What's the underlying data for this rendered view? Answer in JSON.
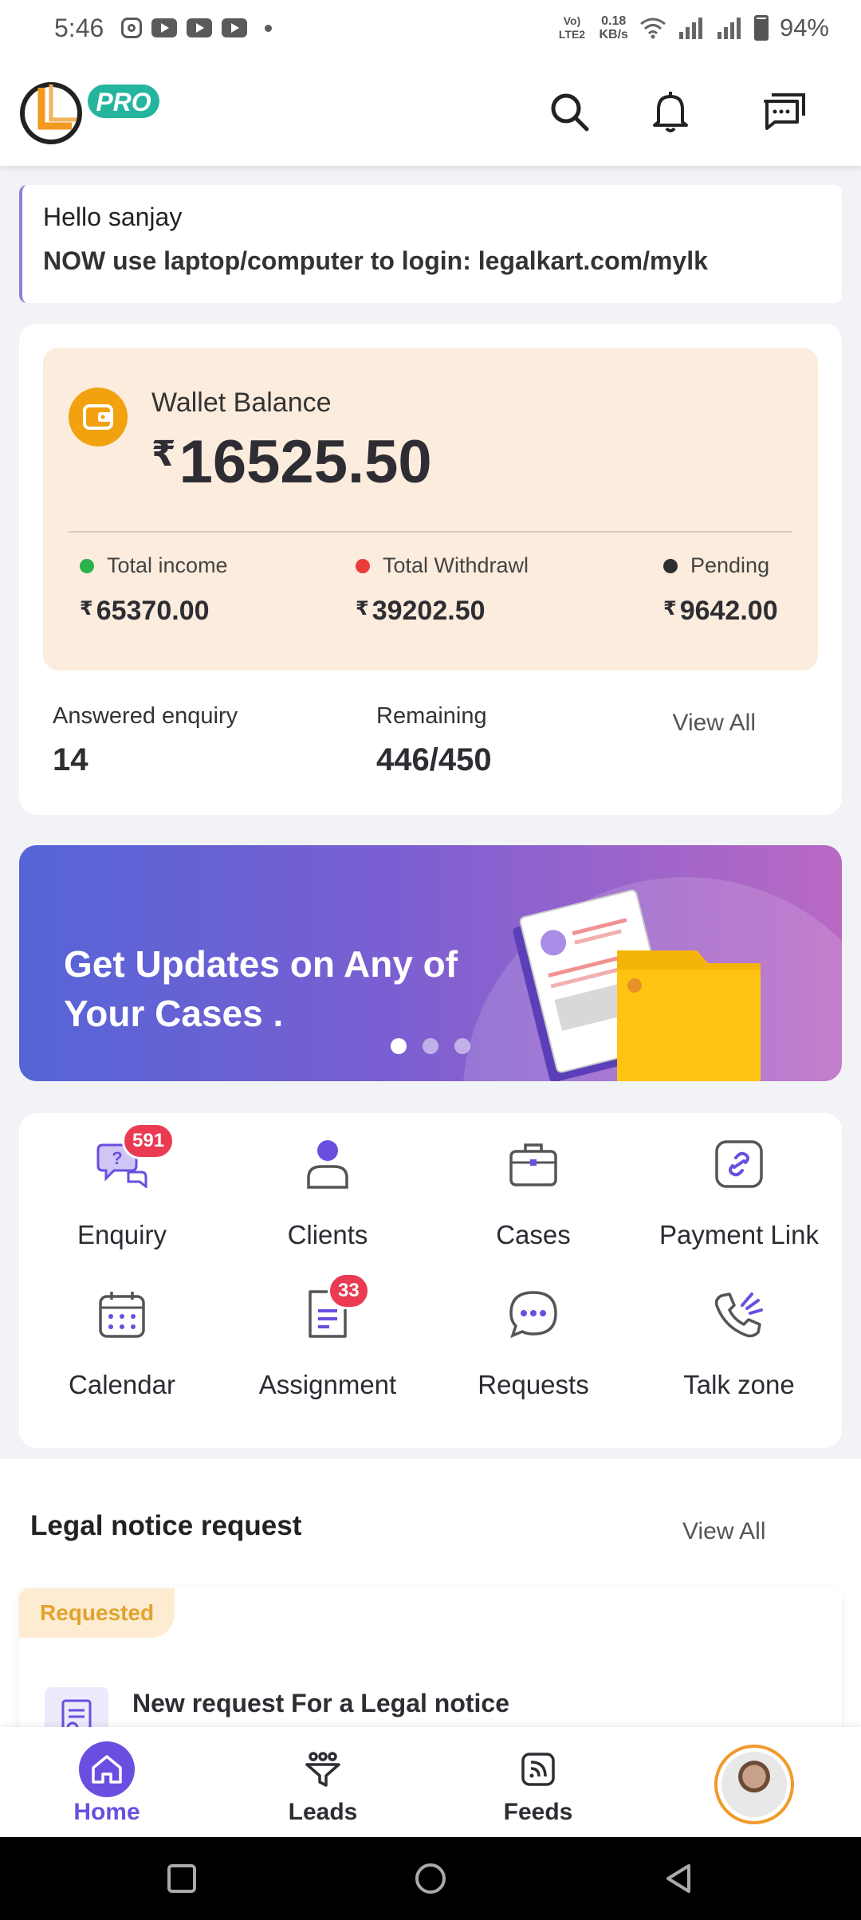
{
  "status_bar": {
    "time": "5:46",
    "network_line1": "Vo) LTE2",
    "speed_line1": "0.18",
    "speed_line2": "KB/s",
    "battery": "94%"
  },
  "header": {
    "logo_badge": "PRO"
  },
  "greeting": {
    "hello": "Hello sanjay",
    "notice": "NOW use laptop/computer to login: legalkart.com/mylk"
  },
  "wallet": {
    "title": "Wallet Balance",
    "currency": "₹",
    "balance": "16525.50",
    "stats": [
      {
        "label": "Total income",
        "value": "65370.00",
        "color": "#2bb24c"
      },
      {
        "label": "Total Withdrawl",
        "value": "39202.50",
        "color": "#ec3b3b"
      },
      {
        "label": "Pending",
        "value": "9642.00",
        "color": "#2d2d33"
      }
    ]
  },
  "enquiry": {
    "answered_label": "Answered enquiry",
    "answered_value": "14",
    "remaining_label": "Remaining",
    "remaining_value": "446/450",
    "view_all": "View All"
  },
  "banner": {
    "text": "Get Updates on Any of Your Cases ."
  },
  "grid": [
    {
      "label": "Enquiry",
      "badge": "591",
      "icon": "enquiry-icon"
    },
    {
      "label": "Clients",
      "badge": null,
      "icon": "clients-icon"
    },
    {
      "label": "Cases",
      "badge": null,
      "icon": "briefcase-icon"
    },
    {
      "label": "Payment Link",
      "badge": null,
      "icon": "payment-link-icon"
    },
    {
      "label": "Calendar",
      "badge": null,
      "icon": "calendar-icon"
    },
    {
      "label": "Assignment",
      "badge": "33",
      "icon": "assignment-icon"
    },
    {
      "label": "Requests",
      "badge": null,
      "icon": "requests-icon"
    },
    {
      "label": "Talk zone",
      "badge": null,
      "icon": "phone-icon"
    }
  ],
  "legal_notice": {
    "title": "Legal notice request",
    "view_all": "View All",
    "status": "Requested",
    "item_title": "New request For a Legal notice"
  },
  "bottom_nav": [
    {
      "label": "Home"
    },
    {
      "label": "Leads"
    },
    {
      "label": "Feeds"
    }
  ],
  "colors": {
    "accent": "#6a4ee0",
    "wallet_bg": "#fbecdd",
    "badge": "#ea3b52",
    "wallet_icon": "#f2a20f"
  }
}
